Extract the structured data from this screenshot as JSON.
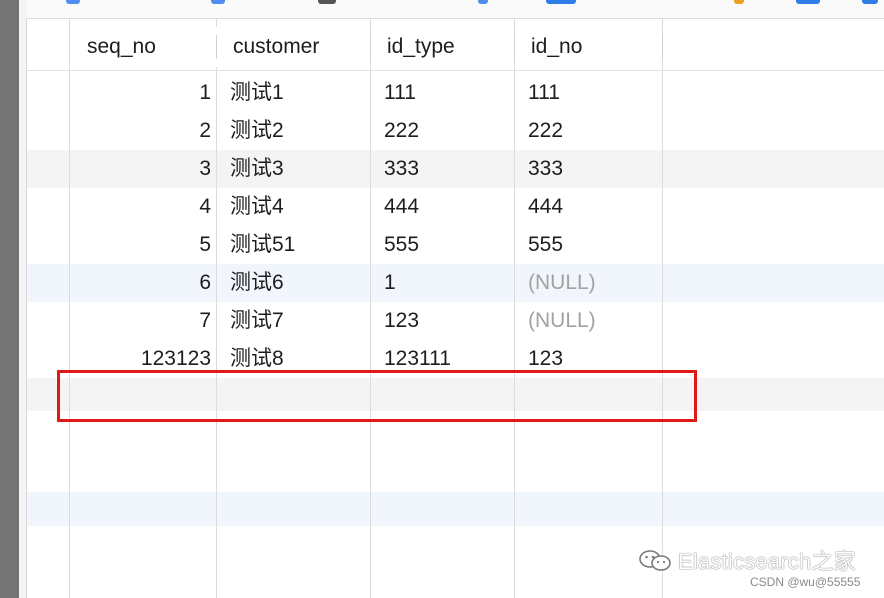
{
  "columns": [
    "seq_no",
    "customer",
    "id_type",
    "id_no"
  ],
  "rows": [
    {
      "seq_no": "1",
      "customer": "测试1",
      "id_type": "111",
      "id_no": "111"
    },
    {
      "seq_no": "2",
      "customer": "测试2",
      "id_type": "222",
      "id_no": "222"
    },
    {
      "seq_no": "3",
      "customer": "测试3",
      "id_type": "333",
      "id_no": "333"
    },
    {
      "seq_no": "4",
      "customer": "测试4",
      "id_type": "444",
      "id_no": "444"
    },
    {
      "seq_no": "5",
      "customer": "测试51",
      "id_type": "555",
      "id_no": "555"
    },
    {
      "seq_no": "6",
      "customer": "测试6",
      "id_type": "1",
      "id_no": "(NULL)"
    },
    {
      "seq_no": "7",
      "customer": "测试7",
      "id_type": "123",
      "id_no": "(NULL)"
    },
    {
      "seq_no": "123123",
      "customer": "测试8",
      "id_type": "123111",
      "id_no": "123"
    }
  ],
  "watermark": {
    "text": "Elasticsearch之家",
    "icon": "wechat-icon"
  },
  "credit": "CSDN @wu@55555",
  "colors": {
    "highlight": "#e01818",
    "null_text": "#a2a2a2",
    "alt_row": "#f4f4f4",
    "selected_row": "#f1f6fd"
  }
}
